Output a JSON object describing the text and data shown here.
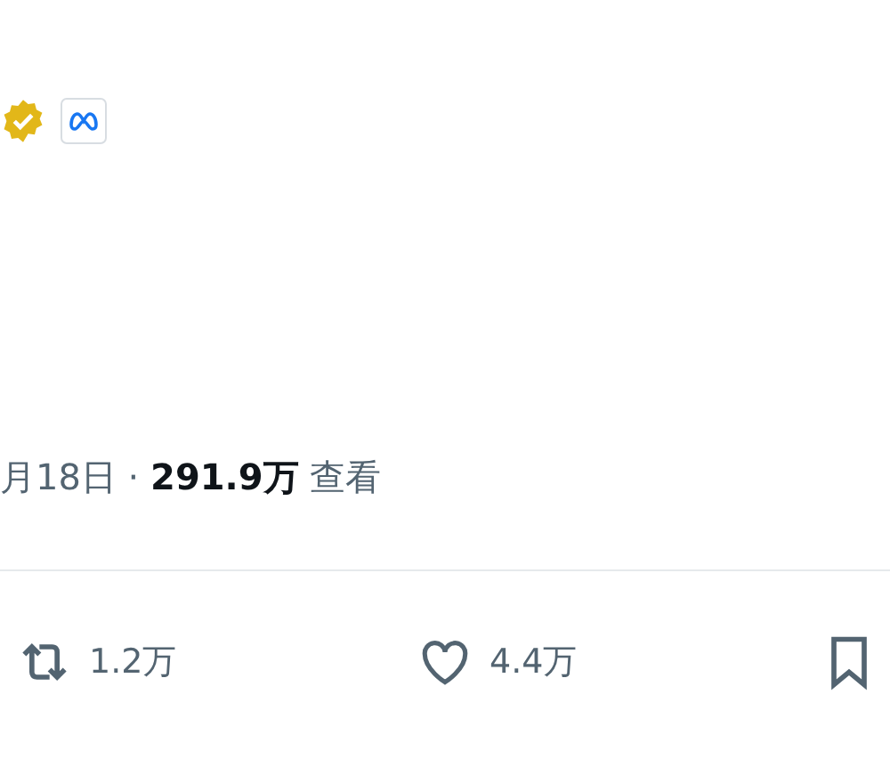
{
  "header": {
    "verified": true,
    "affiliate_badge": true
  },
  "meta_line": "月18日 · **291.9万** 查看",
  "actions": [
    {
      "kind": "retweet",
      "count": "1.2万"
    },
    {
      "kind": "like",
      "count": "4.4万"
    },
    {
      "kind": "bookmark"
    }
  ]
}
